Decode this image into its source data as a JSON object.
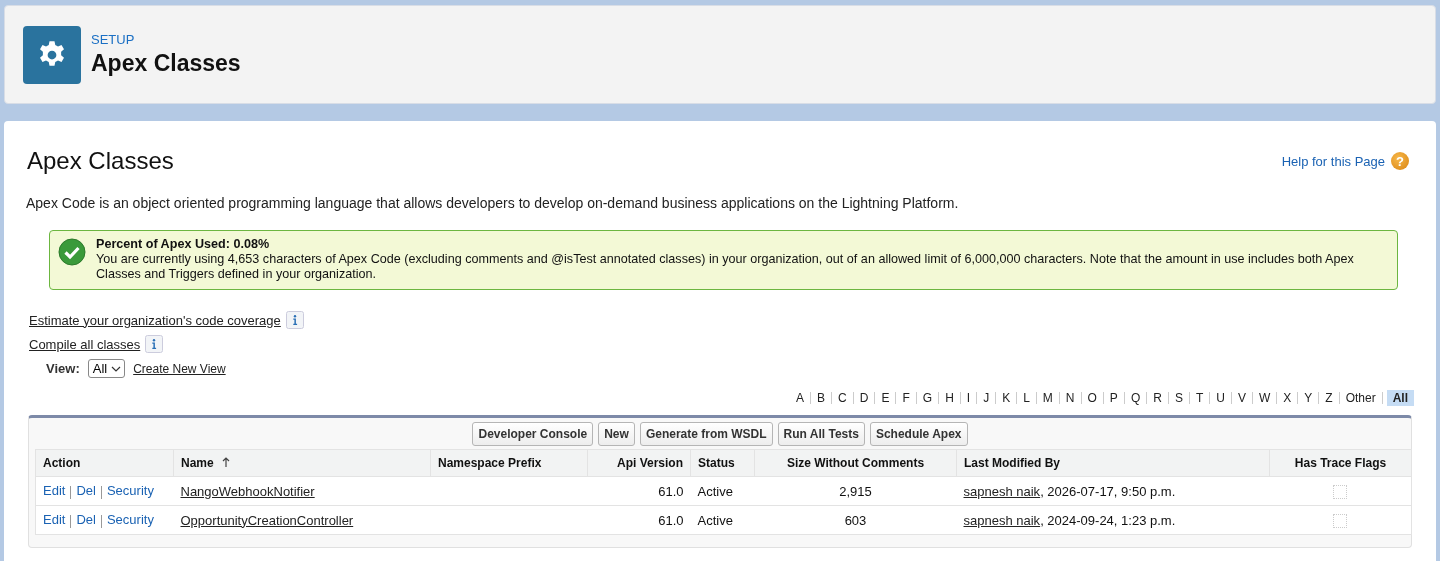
{
  "header": {
    "eyebrow": "SETUP",
    "title": "Apex Classes"
  },
  "page": {
    "title": "Apex Classes",
    "help_link": "Help for this Page",
    "help_glyph": "?",
    "description": "Apex Code is an object oriented programming language that allows developers to develop on-demand business applications on the Lightning Platform."
  },
  "message": {
    "title": "Percent of Apex Used: 0.08%",
    "text": "You are currently using 4,653 characters of Apex Code (excluding comments and @isTest annotated classes) in your organization, out of an allowed limit of 6,000,000 characters. Note that the amount in use includes both Apex Classes and Triggers defined in your organization."
  },
  "links": [
    "Estimate your organization's code coverage",
    "Compile all classes"
  ],
  "view": {
    "label": "View:",
    "value": "All",
    "create_link": "Create New View"
  },
  "alphabet": [
    {
      "label": "A",
      "selected": false
    },
    {
      "label": "B",
      "selected": false
    },
    {
      "label": "C",
      "selected": false
    },
    {
      "label": "D",
      "selected": false
    },
    {
      "label": "E",
      "selected": false
    },
    {
      "label": "F",
      "selected": false
    },
    {
      "label": "G",
      "selected": false
    },
    {
      "label": "H",
      "selected": false
    },
    {
      "label": "I",
      "selected": false
    },
    {
      "label": "J",
      "selected": false
    },
    {
      "label": "K",
      "selected": false
    },
    {
      "label": "L",
      "selected": false
    },
    {
      "label": "M",
      "selected": false
    },
    {
      "label": "N",
      "selected": false
    },
    {
      "label": "O",
      "selected": false
    },
    {
      "label": "P",
      "selected": false
    },
    {
      "label": "Q",
      "selected": false
    },
    {
      "label": "R",
      "selected": false
    },
    {
      "label": "S",
      "selected": false
    },
    {
      "label": "T",
      "selected": false
    },
    {
      "label": "U",
      "selected": false
    },
    {
      "label": "V",
      "selected": false
    },
    {
      "label": "W",
      "selected": false
    },
    {
      "label": "X",
      "selected": false
    },
    {
      "label": "Y",
      "selected": false
    },
    {
      "label": "Z",
      "selected": false
    },
    {
      "label": "Other",
      "selected": false
    },
    {
      "label": "All",
      "selected": true
    }
  ],
  "buttons": [
    "Developer Console",
    "New",
    "Generate from WSDL",
    "Run All Tests",
    "Schedule Apex"
  ],
  "table": {
    "columns": [
      {
        "label": "Action",
        "sorted": false
      },
      {
        "label": "Name",
        "sorted": true
      },
      {
        "label": "Namespace Prefix",
        "sorted": false
      },
      {
        "label": "Api Version",
        "sorted": false
      },
      {
        "label": "Status",
        "sorted": false
      },
      {
        "label": "Size Without Comments",
        "sorted": false
      },
      {
        "label": "Last Modified By",
        "sorted": false
      },
      {
        "label": "Has Trace Flags",
        "sorted": false
      }
    ],
    "rows": [
      {
        "actions": [
          "Edit",
          "Del",
          "Security"
        ],
        "name": "NangoWebhookNotifier",
        "api_version": "61.0",
        "status": "Active",
        "size": "2,915",
        "modified_by": "sapnesh naik",
        "modified_at": ", 2026-07-17, 9:50 p.m.",
        "has_trace_flags": false
      },
      {
        "actions": [
          "Edit",
          "Del",
          "Security"
        ],
        "name": "OpportunityCreationController",
        "api_version": "61.0",
        "status": "Active",
        "size": "603",
        "modified_by": "sapnesh naik",
        "modified_at": ", 2024-09-24, 1:23 p.m.",
        "has_trace_flags": false
      }
    ]
  }
}
